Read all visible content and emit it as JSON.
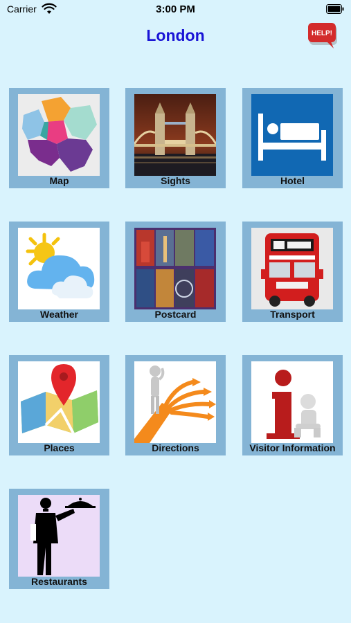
{
  "status_bar": {
    "carrier": "Carrier",
    "time": "3:00 PM"
  },
  "header": {
    "title": "London",
    "help_label": "HELP!"
  },
  "colors": {
    "background": "#d9f3fd",
    "title": "#1a14d6",
    "tile_frame": "#84b4d5",
    "help_red": "#d32b2b"
  },
  "grid": {
    "items": [
      {
        "label": "Map",
        "icon": "map-icon"
      },
      {
        "label": "Sights",
        "icon": "tower-bridge-icon"
      },
      {
        "label": "Hotel",
        "icon": "bed-icon"
      },
      {
        "label": "Weather",
        "icon": "sun-cloud-icon"
      },
      {
        "label": "Postcard",
        "icon": "postcard-collage-icon"
      },
      {
        "label": "Transport",
        "icon": "double-decker-bus-icon"
      },
      {
        "label": "Places",
        "icon": "map-pin-icon"
      },
      {
        "label": "Directions",
        "icon": "directions-arrows-icon"
      },
      {
        "label": "Visitor Information",
        "icon": "info-icon"
      },
      {
        "label": "Restaurants",
        "icon": "waiter-icon"
      }
    ]
  }
}
